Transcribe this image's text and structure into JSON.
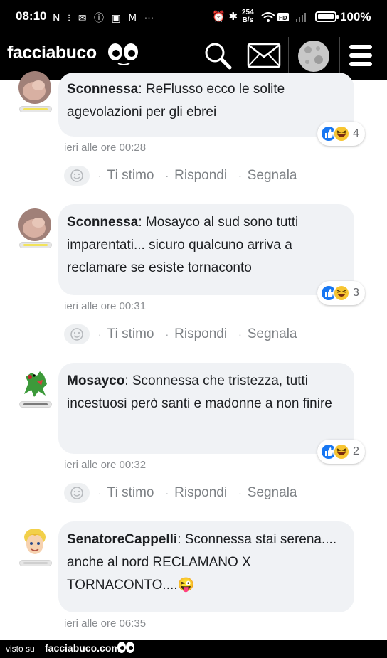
{
  "status_bar": {
    "time": "08:10",
    "left_icons": "N ⁝ ✉ ⓘ ▣ M ⋯",
    "right_icons": "⏰ ✱",
    "net_speed_value": "254",
    "net_speed_unit": "B/s",
    "battery": "100%"
  },
  "header": {
    "logo_text": "facciabuco",
    "icons": [
      "search-icon",
      "mail-icon",
      "moon-icon",
      "menu-icon"
    ]
  },
  "comments": [
    {
      "author": "Sconnessa",
      "text": ": ReFlusso ecco le solite agevolazioni per gli ebrei",
      "reaction_count": "4",
      "time": "ieri alle ore 00:28",
      "avatar": "avatar-photo",
      "rank_color": "#f2e35a"
    },
    {
      "author": "Sconnessa",
      "text": ": Mosayco al sud sono tutti imparentati... sicuro qualcuno arriva a reclamare se esiste tornaconto",
      "reaction_count": "3",
      "time": "ieri alle ore 00:31",
      "avatar": "avatar-photo",
      "rank_color": "#f2e35a"
    },
    {
      "author": "Mosayco",
      "text": ": Sconnessa che tristezza, tutti incestuosi però santi e madonne a non finire",
      "reaction_count": "2",
      "time": "ieri alle ore 00:32",
      "avatar": "dinosaur-avatar",
      "rank_color": "#7a7a7a"
    },
    {
      "author": "SenatoreCappelli",
      "text": ": Sconnessa stai serena.... anche al nord RECLAMANO X TORNACONTO....",
      "emoji": "😜",
      "time": "ieri alle ore 06:35",
      "avatar": "blond-cartoon-avatar",
      "rank_color": "#cfcfcf"
    }
  ],
  "actions": {
    "like": "Ti stimo",
    "reply": "Rispondi",
    "report": "Segnala"
  },
  "footer": {
    "visto_su": "visto su",
    "site": "facciabuco.com"
  },
  "colors": {
    "bubble": "#f0f2f5",
    "like_blue": "#1877f2",
    "meta_gray": "#8a8d91"
  }
}
